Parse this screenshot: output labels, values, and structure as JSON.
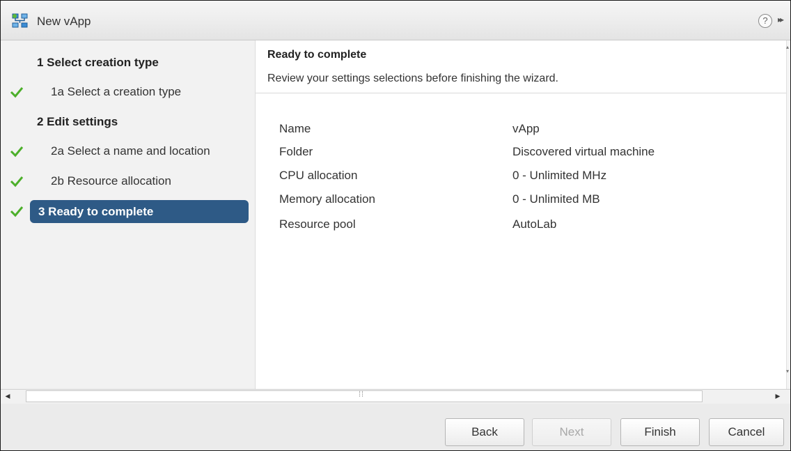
{
  "window": {
    "title": "New vApp"
  },
  "titlebar": {
    "help_glyph": "?",
    "expand_glyph": "▸▸"
  },
  "sidebar": {
    "steps": [
      {
        "label": "1 Select creation type"
      },
      {
        "label": "1a Select a creation type",
        "completed": true
      },
      {
        "label": "2 Edit settings"
      },
      {
        "label": "2a Select a name and location",
        "completed": true
      },
      {
        "label": "2b Resource allocation",
        "completed": true
      },
      {
        "label": "3 Ready to complete",
        "completed": true,
        "active": true
      }
    ]
  },
  "content": {
    "title": "Ready to complete",
    "subtitle": "Review your settings selections before finishing the wizard.",
    "summary": [
      {
        "label": "Name",
        "value": "vApp"
      },
      {
        "label": "Folder",
        "value": "Discovered virtual machine"
      },
      {
        "label": "CPU allocation",
        "value": "0 - Unlimited MHz"
      },
      {
        "label": "Memory allocation",
        "value": "0 - Unlimited MB"
      },
      {
        "label": "Resource pool",
        "value": "AutoLab"
      }
    ]
  },
  "footer": {
    "back_label": "Back",
    "next_label": "Next",
    "finish_label": "Finish",
    "cancel_label": "Cancel"
  },
  "colors": {
    "accent": "#2e5a86",
    "check": "#4caf2a"
  },
  "icons": [
    "vapp-icon",
    "help-icon",
    "expand-icon",
    "check-icon",
    "scroll-left-icon",
    "scroll-right-icon"
  ]
}
